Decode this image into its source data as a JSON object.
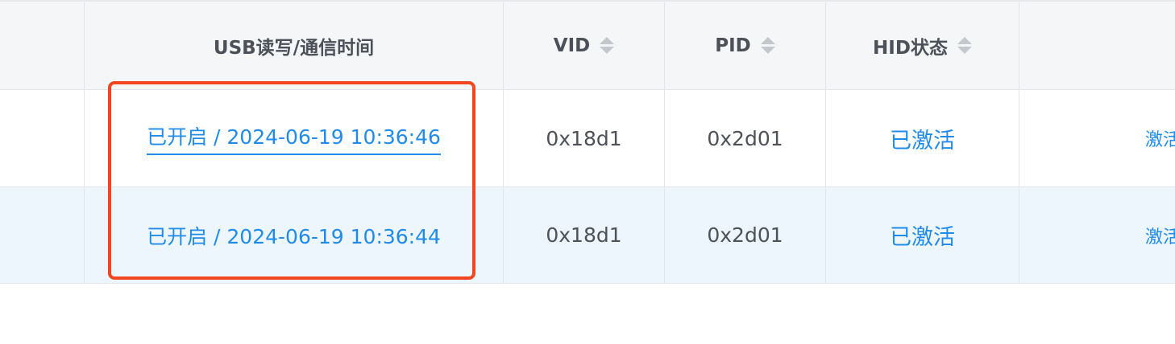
{
  "header": {
    "col_usb": "USB读写/通信时间",
    "col_vid": "VID",
    "col_pid": "PID",
    "col_hid": "HID状态"
  },
  "rows": [
    {
      "usb_time": "已开启 / 2024-06-19 10:36:46",
      "vid": "0x18d1",
      "pid": "0x2d01",
      "hid_status": "已激活",
      "action": "激活"
    },
    {
      "usb_time": "已开启 / 2024-06-19 10:36:44",
      "vid": "0x18d1",
      "pid": "0x2d01",
      "hid_status": "已激活",
      "action": "激活"
    }
  ],
  "colors": {
    "link": "#1f8ceb",
    "highlight_border": "#f2461e",
    "selected_row_bg": "#edf5fd",
    "header_bg": "#f5f6f8"
  },
  "icons": {
    "sort": "sort-icon"
  }
}
